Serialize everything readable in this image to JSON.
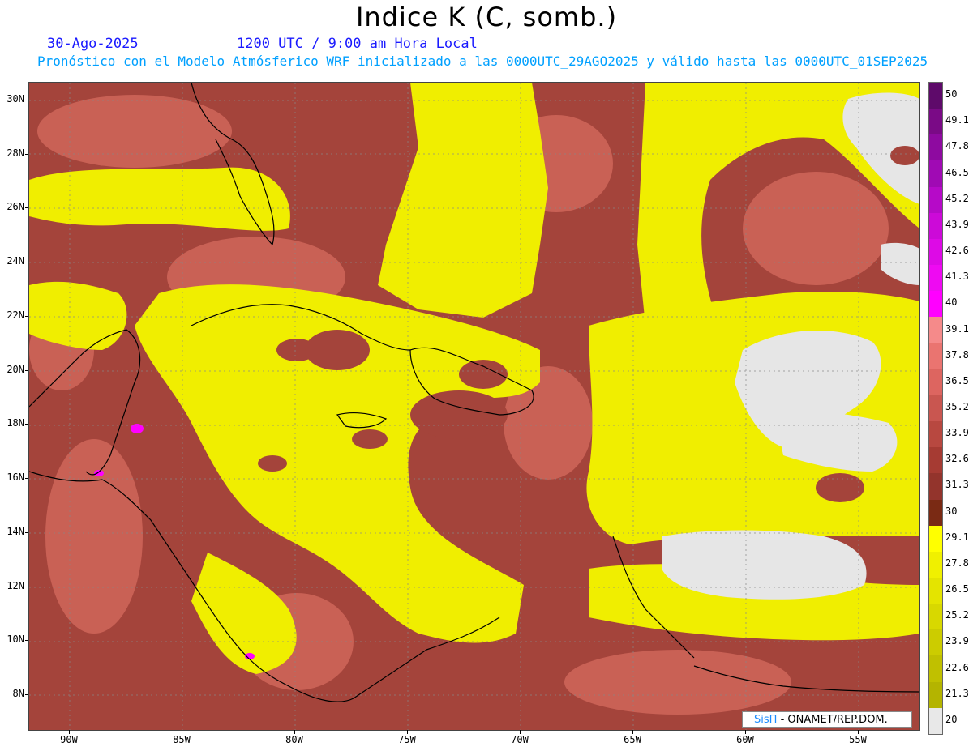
{
  "title": "Indice K (C, somb.)",
  "date": "30-Ago-2025",
  "time": "1200 UTC / 9:00 am Hora Local",
  "forecast": "Pronóstico con el Modelo Atmósferico WRF inicializado a las 0000UTC_29AGO2025 y válido hasta las  0000UTC_01SEP2025",
  "credit": {
    "logo": "SisΠ",
    "text": "- ONAMET/REP.DOM."
  },
  "lat_labels": [
    "30N",
    "28N",
    "26N",
    "24N",
    "22N",
    "20N",
    "18N",
    "16N",
    "14N",
    "12N",
    "10N",
    "8N"
  ],
  "lon_labels": [
    "90W",
    "85W",
    "80W",
    "75W",
    "70W",
    "65W",
    "60W",
    "55W"
  ],
  "colorbar": {
    "labels": [
      "50",
      "49.1",
      "47.8",
      "46.5",
      "45.2",
      "43.9",
      "42.6",
      "41.3",
      "40",
      "39.1",
      "37.8",
      "36.5",
      "35.2",
      "33.9",
      "32.6",
      "31.3",
      "30",
      "29.1",
      "27.8",
      "26.5",
      "25.2",
      "23.9",
      "22.6",
      "21.3",
      "20"
    ],
    "colors": [
      "#5e0a6a",
      "#7a0a86",
      "#8e0aa0",
      "#a00ab4",
      "#b60ac8",
      "#cc0ad8",
      "#dd0ae6",
      "#ee0af2",
      "#ff00ff",
      "#f58a8a",
      "#ea7470",
      "#dd6560",
      "#c95650",
      "#b84840",
      "#a63b33",
      "#93342c",
      "#7a2a14",
      "#ffff00",
      "#f0f000",
      "#e4e400",
      "#d8d800",
      "#cccc00",
      "#c0c000",
      "#b4b400",
      "#e8e8e8"
    ]
  },
  "colors": {
    "warm": "#a4443b",
    "light_warm": "#d96a5e",
    "yellow": "#f2f000",
    "gray": "#e6e6e6",
    "magenta": "#ff00ff"
  }
}
